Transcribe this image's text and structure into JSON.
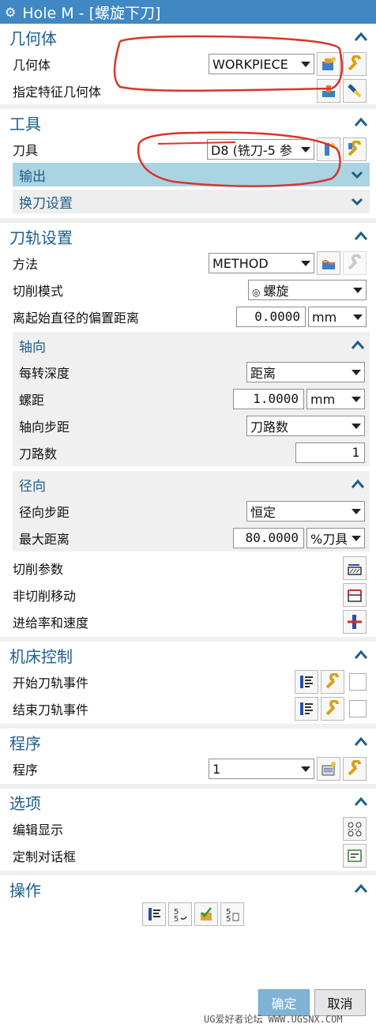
{
  "window": {
    "title": "Hole M - [螺旋下刀]",
    "icon": "gear-icon"
  },
  "geometry": {
    "title": "几何体",
    "label": "几何体",
    "select_value": "WORKPIECE",
    "feature_label": "指定特征几何体"
  },
  "tool": {
    "title": "工具",
    "label": "刀具",
    "select_value": "D8 (铣刀-5 参",
    "output_label": "输出",
    "toolchange_label": "换刀设置"
  },
  "path": {
    "title": "刀轨设置",
    "method_label": "方法",
    "method_value": "METHOD",
    "cut_mode_label": "切削模式",
    "cut_mode_value": "螺旋",
    "offset_label": "离起始直径的偏置距离",
    "offset_value": "0.0000",
    "offset_unit": "mm",
    "axial": {
      "title": "轴向",
      "depth_label": "每转深度",
      "depth_value": "距离",
      "pitch_label": "螺距",
      "pitch_value": "1.0000",
      "pitch_unit": "mm",
      "step_label": "轴向步距",
      "step_value": "刀路数",
      "passes_label": "刀路数",
      "passes_value": "1"
    },
    "radial": {
      "title": "径向",
      "step_label": "径向步距",
      "step_value": "恒定",
      "max_label": "最大距离",
      "max_value": "80.0000",
      "max_unit": "%刀具"
    },
    "cut_params_label": "切削参数",
    "noncut_label": "非切削移动",
    "feeds_label": "进给率和速度"
  },
  "machine": {
    "title": "机床控制",
    "start_label": "开始刀轨事件",
    "end_label": "结束刀轨事件"
  },
  "program": {
    "title": "程序",
    "label": "程序",
    "value": "1"
  },
  "options": {
    "title": "选项",
    "edit_display_label": "编辑显示",
    "custom_dialog_label": "定制对话框"
  },
  "actions": {
    "title": "操作"
  },
  "buttons": {
    "ok": "确定",
    "cancel": "取消"
  },
  "watermark": "UG爱好者论坛 WWW.UGSNX.COM",
  "colors": {
    "title_bar": "#3f88c4",
    "header_text": "#1f5e8a",
    "sub_bar": "#abd4e3",
    "ok_button": "#7fb3d6",
    "annotation": "#d9352b"
  }
}
